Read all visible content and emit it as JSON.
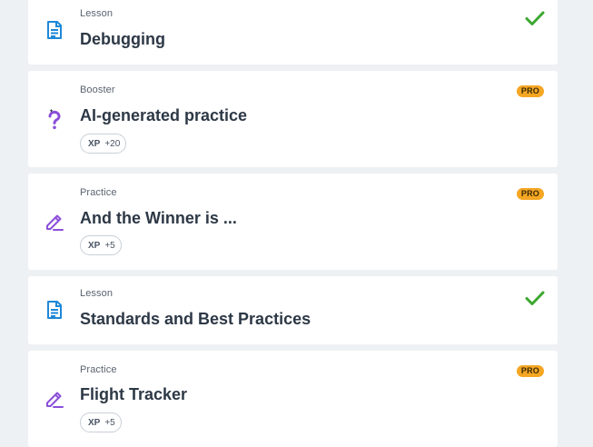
{
  "colors": {
    "page_bg": "#eef1f4",
    "card_bg": "#ffffff",
    "lesson_icon": "#1e88d8",
    "purple_icon": "#8b4fd9",
    "check_green": "#3ca830",
    "pro_badge": "#f5a623"
  },
  "items": [
    {
      "kind": "Lesson",
      "title": "Debugging",
      "icon": "document-icon",
      "status": "completed-check-icon"
    },
    {
      "kind": "Booster",
      "title": "AI-generated practice",
      "icon": "question-sparkle-icon",
      "badge": "PRO",
      "xp_label": "XP",
      "xp_value": "+20"
    },
    {
      "kind": "Practice",
      "title": "And the Winner is ...",
      "icon": "pencil-edit-icon",
      "badge": "PRO",
      "xp_label": "XP",
      "xp_value": "+5"
    },
    {
      "kind": "Lesson",
      "title": "Standards and Best Practices",
      "icon": "document-icon",
      "status": "completed-check-icon"
    },
    {
      "kind": "Practice",
      "title": "Flight Tracker",
      "icon": "pencil-edit-icon",
      "badge": "PRO",
      "xp_label": "XP",
      "xp_value": "+5"
    }
  ]
}
